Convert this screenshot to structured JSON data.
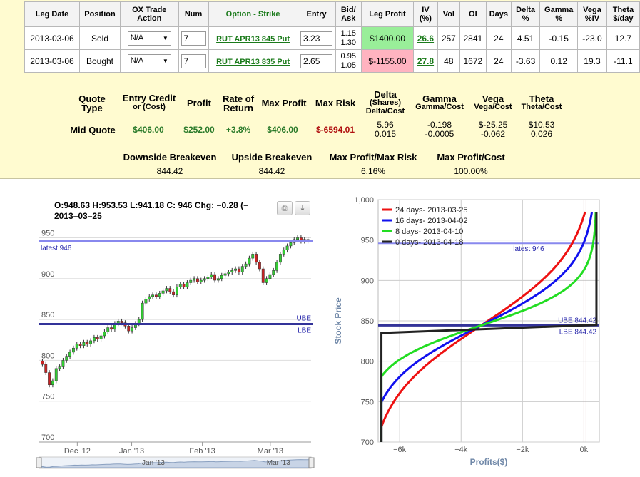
{
  "legs_table": {
    "headers": [
      "Leg Date",
      "Position",
      "OX Trade Action",
      "Num",
      "Option - Strike",
      "Entry",
      "Bid/ Ask",
      "Leg Profit",
      "IV (%)",
      "Vol",
      "OI",
      "Days",
      "Delta %",
      "Gamma %",
      "Vega %IV",
      "Theta $/day"
    ],
    "rows": [
      {
        "date": "2013-03-06",
        "position": "Sold",
        "action": "N/A",
        "num": "7",
        "option": "RUT APR13 845 Put",
        "entry": "3.23",
        "bid": "1.15",
        "ask": "1.30",
        "leg_profit": "$1400.00",
        "iv": "26.6",
        "vol": "257",
        "oi": "2841",
        "days": "24",
        "delta": "4.51",
        "gamma": "-0.15",
        "vega": "-23.0",
        "theta": "12.7"
      },
      {
        "date": "2013-03-06",
        "position": "Bought",
        "action": "N/A",
        "num": "7",
        "option": "RUT APR13 835 Put",
        "entry": "2.65",
        "bid": "0.95",
        "ask": "1.05",
        "leg_profit": "$-1155.00",
        "iv": "27.8",
        "vol": "48",
        "oi": "1672",
        "days": "24",
        "delta": "-3.63",
        "gamma": "0.12",
        "vega": "19.3",
        "theta": "-11.1"
      }
    ]
  },
  "summary": {
    "headers": {
      "quote_type": "Quote Type",
      "entry_credit": "Entry Credit",
      "entry_credit_sub": "or (Cost)",
      "profit": "Profit",
      "ror": "Rate of Return",
      "max_profit": "Max Profit",
      "max_risk": "Max Risk",
      "delta": "Delta",
      "delta_sub1": "(Shares)",
      "delta_sub2": "Delta/Cost",
      "gamma": "Gamma",
      "gamma_sub": "Gamma/Cost",
      "vega": "Vega",
      "vega_sub": "Vega/Cost",
      "theta": "Theta",
      "theta_sub": "Theta/Cost"
    },
    "row": {
      "quote_type": "Mid Quote",
      "entry_credit": "$406.00",
      "profit": "$252.00",
      "ror": "+3.8%",
      "max_profit": "$406.00",
      "max_risk": "$-6594.01",
      "delta": "5.96",
      "delta_cost": "0.015",
      "gamma": "-0.198",
      "gamma_cost": "-0.0005",
      "vega": "$-25.25",
      "vega_cost": "-0.062",
      "theta": "$10.53",
      "theta_cost": "0.026"
    },
    "breakeven_headers": [
      "Downside Breakeven",
      "Upside Breakeven",
      "Max Profit/Max Risk",
      "Max Profit/Cost"
    ],
    "breakeven_values": [
      "844.42",
      "844.42",
      "6.16%",
      "100.00%"
    ]
  },
  "price_chart": {
    "ohlc_text": "O:948.63 H:953.53 L:941.18 C: 946 Chg: −0.28 (−",
    "date_text": "2013–03–25",
    "latest_label": "latest 946",
    "ube_label": "UBE",
    "lbe_label": "LBE",
    "nav_labels": [
      "Jan '13",
      "Mar '13"
    ]
  },
  "chart_data": [
    {
      "type": "candlestick",
      "ylim": [
        700,
        960
      ],
      "yticks": [
        700,
        750,
        800,
        850,
        900,
        950
      ],
      "xticks": [
        "Dec '12",
        "Jan '13",
        "Feb '13",
        "Mar '13"
      ],
      "reference_lines": [
        {
          "name": "latest",
          "value": 946,
          "color": "#8888ee"
        },
        {
          "name": "UBE/LBE",
          "value": 844.42,
          "color": "#333399"
        }
      ],
      "up_color": "#33cc33",
      "down_color": "#cc2222",
      "close": [
        795,
        785,
        770,
        775,
        790,
        792,
        800,
        805,
        810,
        815,
        820,
        818,
        822,
        820,
        824,
        828,
        826,
        830,
        835,
        840,
        838,
        845,
        848,
        846,
        842,
        836,
        840,
        845,
        850,
        870,
        875,
        878,
        880,
        878,
        882,
        885,
        888,
        884,
        880,
        890,
        893,
        890,
        895,
        898,
        900,
        896,
        898,
        900,
        902,
        905,
        898,
        900,
        904,
        906,
        908,
        910,
        912,
        908,
        915,
        918,
        925,
        930,
        920,
        912,
        895,
        900,
        905,
        910,
        920,
        930,
        935,
        940,
        944,
        948,
        950,
        946,
        948,
        946
      ]
    },
    {
      "type": "line",
      "title": "",
      "xlabel": "Profits($)",
      "ylabel": "Stock Price",
      "xlim": [
        -6700,
        500
      ],
      "ylim": [
        700,
        1000
      ],
      "xticks": [
        -6000,
        -4000,
        -2000,
        0
      ],
      "xtick_labels": [
        "−6k",
        "−4k",
        "−2k",
        "0k"
      ],
      "yticks": [
        700,
        750,
        800,
        850,
        900,
        950,
        1000
      ],
      "ytick_labels": [
        "700",
        "750",
        "800",
        "850",
        "900",
        "950",
        "1,000"
      ],
      "latest_label": "latest 946",
      "ube_label": "UBE 844.42",
      "lbe_label": "LBE 844.42",
      "latest": 946,
      "breakeven": 844.42,
      "series": [
        {
          "name": "24 days- 2013-03-25",
          "color": "#ee1111"
        },
        {
          "name": "16 days- 2013-04-02",
          "color": "#1111ee"
        },
        {
          "name": "8 days- 2013-04-10",
          "color": "#22dd22"
        },
        {
          "name": "0 days- 2013-04-18",
          "color": "#222222"
        }
      ]
    }
  ]
}
